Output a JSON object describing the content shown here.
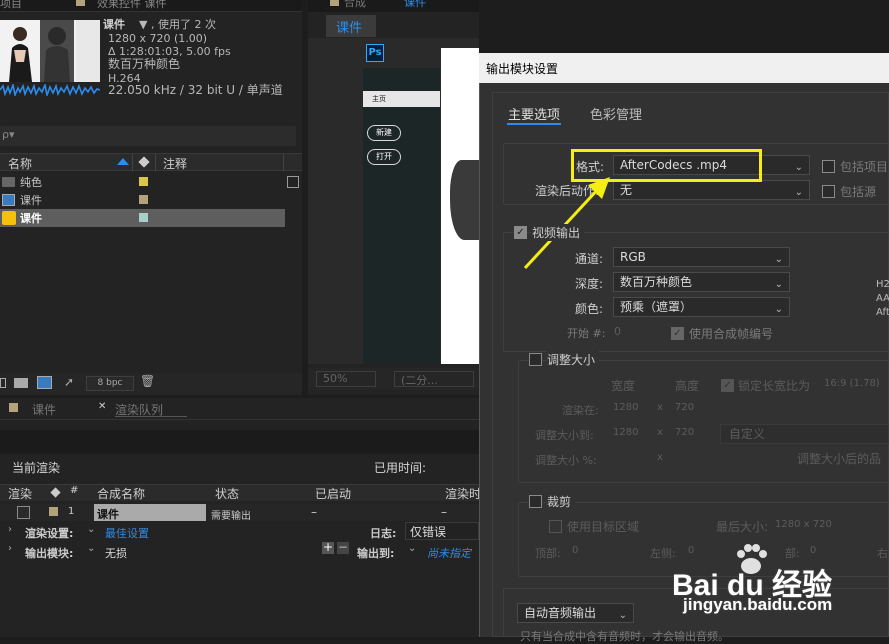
{
  "project": {
    "tabs": [
      "项目",
      "效果控件 课件"
    ],
    "footage_name": "课件",
    "footage_meta": "▼ , 使用了 2 次",
    "resolution": "1280 x 720 (1.00)",
    "duration": "Δ 1:28:01:03, 5.00 fps",
    "color_depth": "数百万种颜色",
    "codec": "H.264",
    "audio": "22.050 kHz / 32 bit U / 单声道",
    "search_placeholder": "ρ▾",
    "col_name": "名称",
    "col_comment": "注释",
    "items": [
      {
        "name": "纯色",
        "color": "#d8c84a"
      },
      {
        "name": "课件",
        "color": "#b3a27a"
      },
      {
        "name": "课件",
        "color": "#a9cfc9"
      }
    ],
    "bpc": "8 bpc"
  },
  "viewer": {
    "comp_tab": "课件",
    "comp_header": "合成",
    "comp_header_name": "课件",
    "ps_icon": "Ps",
    "ps_home": "主页",
    "ps_new": "新建",
    "ps_open": "打开",
    "zoom": "50%",
    "res": "(二分..."
  },
  "render_queue": {
    "tab_comp": "课件",
    "tab_rq": "渲染队列",
    "current_render": "当前渲染",
    "elapsed": "已用时间:",
    "headers": [
      "渲染",
      "#",
      "合成名称",
      "状态",
      "已启动",
      "渲染时"
    ],
    "item_index": "1",
    "item_name": "课件",
    "item_status": "需要输出",
    "item_started": "–",
    "item_time": "–",
    "settings_label": "渲染设置:",
    "settings_value": "最佳设置",
    "log_label": "日志:",
    "log_value": "仅错误",
    "module_label": "输出模块:",
    "module_value": "无损",
    "output_to_label": "输出到:",
    "output_to_value": "尚未指定"
  },
  "dialog": {
    "title": "输出模块设置",
    "tab_main": "主要选项",
    "tab_color": "色彩管理",
    "format_label": "格式:",
    "format_value": "AfterCodecs .mp4",
    "include_project": "包括项目",
    "post_render_label": "渲染后动作:",
    "post_render_value": "无",
    "include_source": "包括源",
    "video_output": "视频输出",
    "channel_label": "通道:",
    "channel_value": "RGB",
    "depth_label": "深度:",
    "depth_value": "数百万种颜色",
    "color_label": "颜色:",
    "color_value": "预乘（遮罩）",
    "start_label": "开始 #:",
    "start_value": "0",
    "use_comp_frame": "使用合成帧编号",
    "side_info": [
      "H2",
      "AA(",
      "Aft"
    ],
    "resize": "调整大小",
    "width_label": "宽度",
    "height_label": "高度",
    "lock_aspect": "锁定长宽比为",
    "aspect_value": "16:9 (1.78)",
    "render_at": "渲染在:",
    "render_w": "1280",
    "render_h": "720",
    "resize_to": "调整大小到:",
    "resize_w": "1280",
    "resize_h": "720",
    "custom": "自定义",
    "resize_pct": "调整大小 %:",
    "resize_after": "调整大小后的品",
    "x": "x",
    "crop": "裁剪",
    "use_target": "使用目标区域",
    "final_size_label": "最后大小:",
    "final_size_value": "1280 x 720",
    "top_label": "顶部:",
    "top_value": "0",
    "left_label": "左侧:",
    "left_value": "0",
    "bottom_label": "部:",
    "bottom_value": "0",
    "right_label": "右",
    "auto_audio": "自动音频输出",
    "audio_note": "只有当合成中含有音频时，才会输出音频。"
  },
  "watermark": {
    "logo": "Bai du 经验",
    "url": "jingyan.baidu.com"
  },
  "colors": {
    "annotation": "#f5ee15",
    "highlight_blue": "#2d8ceb"
  }
}
